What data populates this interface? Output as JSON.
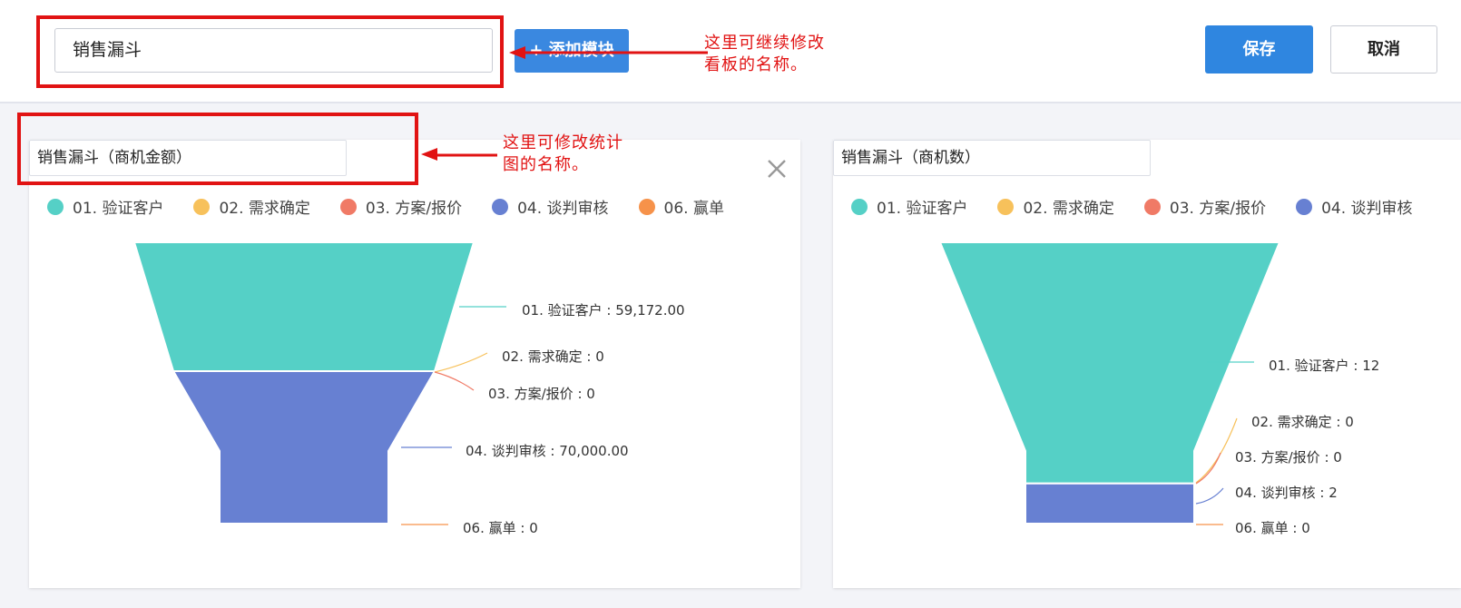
{
  "toolbar": {
    "dashboard_name": "销售漏斗",
    "add_module_label": "+ 添加模块",
    "save_label": "保存",
    "cancel_label": "取消"
  },
  "annotations": {
    "dashboard_note_line1": "这里可继续修改",
    "dashboard_note_line2": "看板的名称。",
    "chart_note_line1": "这里可修改统计",
    "chart_note_line2": "图的名称。",
    "color": "#e11313"
  },
  "legend_colors": {
    "01. 验证客户": "#55d0c6",
    "02. 需求确定": "#f7c15b",
    "03. 方案/报价": "#f07a66",
    "04. 谈判审核": "#6780d2",
    "06. 赢单": "#f6924a"
  },
  "cards": [
    {
      "title": "销售漏斗（商机金额）",
      "legend": [
        "01. 验证客户",
        "02. 需求确定",
        "03. 方案/报价",
        "04. 谈判审核",
        "06. 赢单"
      ],
      "close_icon": "close-icon"
    },
    {
      "title": "销售漏斗（商机数）",
      "legend": [
        "01. 验证客户",
        "02. 需求确定",
        "03. 方案/报价",
        "04. 谈判审核"
      ]
    }
  ],
  "chart_data": [
    {
      "type": "funnel",
      "title": "销售漏斗（商机金额）",
      "categories": [
        "01. 验证客户",
        "02. 需求确定",
        "03. 方案/报价",
        "04. 谈判审核",
        "06. 赢单"
      ],
      "values": [
        59172.0,
        0,
        0,
        70000.0,
        0
      ],
      "labels": [
        "01. 验证客户 : 59,172.00",
        "02. 需求确定 : 0",
        "03. 方案/报价 : 0",
        "04. 谈判审核 : 70,000.00",
        "06. 赢单 : 0"
      ],
      "legend": "top"
    },
    {
      "type": "funnel",
      "title": "销售漏斗（商机数）",
      "categories": [
        "01. 验证客户",
        "02. 需求确定",
        "03. 方案/报价",
        "04. 谈判审核",
        "06. 赢单"
      ],
      "values": [
        12,
        0,
        0,
        2,
        0
      ],
      "labels": [
        "01. 验证客户 : 12",
        "02. 需求确定 : 0",
        "03. 方案/报价 : 0",
        "04. 谈判审核 : 2",
        "06. 赢单 : 0"
      ],
      "legend": "top"
    }
  ]
}
